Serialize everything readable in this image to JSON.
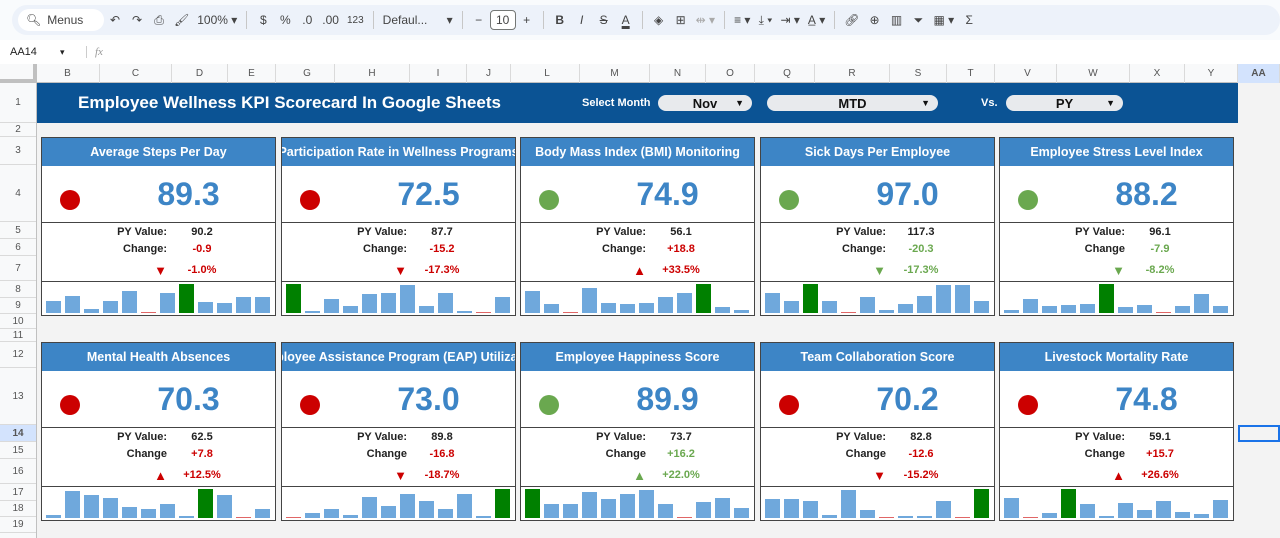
{
  "toolbar": {
    "search": "Menus",
    "zoom": "100%",
    "currency": "$",
    "percent": "%",
    "dec_decrease": ".0",
    "dec_increase": ".00",
    "format_123": "123",
    "font": "Defaul...",
    "font_size": "10",
    "minus": "−",
    "plus": "+",
    "bold": "B",
    "italic": "I"
  },
  "formula_bar": {
    "cell_ref": "AA14",
    "fx": "fx",
    "value": ""
  },
  "columns": [
    "B",
    "C",
    "D",
    "E",
    "G",
    "H",
    "I",
    "J",
    "L",
    "M",
    "N",
    "O",
    "Q",
    "R",
    "S",
    "T",
    "V",
    "W",
    "X",
    "Y",
    "AA"
  ],
  "rows": [
    "1",
    "2",
    "3",
    "4",
    "5",
    "6",
    "7",
    "8",
    "9",
    "10",
    "11",
    "12",
    "13",
    "14",
    "15",
    "16",
    "17",
    "18",
    "19"
  ],
  "header": {
    "title": "Employee Wellness KPI Scorecard In Google Sheets",
    "select_month_label": "Select Month",
    "month": "Nov",
    "period": "MTD",
    "vs_label": "Vs.",
    "comparison": "PY"
  },
  "colors": {
    "title_bg": "#0b5394",
    "card_header": "#3d85c6",
    "value": "#3d85c6",
    "red": "#cc0000",
    "green": "#6aa84f",
    "bar_blue": "#6fa8dc",
    "bar_max": "#008000",
    "bar_min": "#e06666"
  },
  "cards": [
    {
      "title": "Average Steps Per Day",
      "value": "89.3",
      "status": "red",
      "py_label": "PY Value:",
      "py": "90.2",
      "change_label": "Change:",
      "change": "-0.9",
      "pct": "-1.0%",
      "direction": "down",
      "trend": "red",
      "spark": [
        40,
        60,
        15,
        40,
        75,
        2,
        70,
        100,
        38,
        35,
        55,
        55
      ]
    },
    {
      "title": "Participation Rate in Wellness Programs",
      "value": "72.5",
      "status": "red",
      "py_label": "PY Value:",
      "py": "87.7",
      "change_label": "Change:",
      "change": "-15.2",
      "pct": "-17.3%",
      "direction": "down",
      "trend": "red",
      "spark": [
        100,
        8,
        50,
        25,
        65,
        68,
        95,
        25,
        68,
        8,
        2,
        55
      ]
    },
    {
      "title": "Body Mass Index (BMI) Monitoring",
      "value": "74.9",
      "status": "green",
      "py_label": "PY Value:",
      "py": "56.1",
      "change_label": "Change:",
      "change": "+18.8",
      "pct": "+33.5%",
      "direction": "up",
      "trend": "red",
      "spark": [
        75,
        30,
        2,
        85,
        35,
        32,
        35,
        55,
        70,
        100,
        20,
        10
      ]
    },
    {
      "title": "Sick Days Per Employee",
      "value": "97.0",
      "status": "green",
      "py_label": "PY Value:",
      "py": "117.3",
      "change_label": "Change:",
      "change": "-20.3",
      "pct": "-17.3%",
      "direction": "down",
      "trend": "green",
      "spark": [
        70,
        40,
        100,
        40,
        2,
        55,
        10,
        30,
        60,
        95,
        98,
        40
      ]
    },
    {
      "title": "Employee Stress Level Index",
      "value": "88.2",
      "status": "green",
      "py_label": "PY Value:",
      "py": "96.1",
      "change_label": "Change",
      "change": "-7.9",
      "pct": "-8.2%",
      "direction": "down",
      "trend": "green",
      "spark": [
        12,
        48,
        25,
        27,
        30,
        100,
        20,
        27,
        2,
        25,
        65,
        25
      ]
    },
    {
      "title": "Mental Health Absences",
      "value": "70.3",
      "status": "red",
      "py_label": "PY Value:",
      "py": "62.5",
      "change_label": "Change",
      "change": "+7.8",
      "pct": "+12.5%",
      "direction": "up",
      "trend": "red",
      "spark": [
        10,
        92,
        80,
        68,
        38,
        30,
        50,
        7,
        100,
        80,
        2,
        32
      ]
    },
    {
      "title": "Employee Assistance Program (EAP) Utilization",
      "value": "73.0",
      "status": "red",
      "py_label": "PY Value:",
      "py": "89.8",
      "change_label": "Change",
      "change": "-16.8",
      "pct": "-18.7%",
      "direction": "down",
      "trend": "red",
      "spark": [
        2,
        18,
        30,
        12,
        72,
        40,
        82,
        58,
        30,
        82,
        8,
        100
      ]
    },
    {
      "title": "Employee Happiness Score",
      "value": "89.9",
      "status": "green",
      "py_label": "PY Value:",
      "py": "73.7",
      "change_label": "Change",
      "change": "+16.2",
      "pct": "+22.0%",
      "direction": "up",
      "trend": "green",
      "spark": [
        100,
        48,
        50,
        90,
        67,
        82,
        95,
        48,
        2,
        55,
        70,
        33
      ]
    },
    {
      "title": "Team Collaboration Score",
      "value": "70.2",
      "status": "red",
      "py_label": "PY Value:",
      "py": "82.8",
      "change_label": "Change",
      "change": "-12.6",
      "pct": "-15.2%",
      "direction": "down",
      "trend": "red",
      "spark": [
        65,
        65,
        60,
        10,
        95,
        28,
        2,
        8,
        6,
        58,
        2,
        100
      ]
    },
    {
      "title": "Livestock Mortality Rate",
      "value": "74.8",
      "status": "red",
      "py_label": "PY Value:",
      "py": "59.1",
      "change_label": "Change",
      "change": "+15.7",
      "pct": "+26.6%",
      "direction": "up",
      "trend": "red",
      "spark": [
        70,
        2,
        18,
        100,
        48,
        6,
        52,
        28,
        58,
        22,
        13,
        62
      ]
    }
  ]
}
